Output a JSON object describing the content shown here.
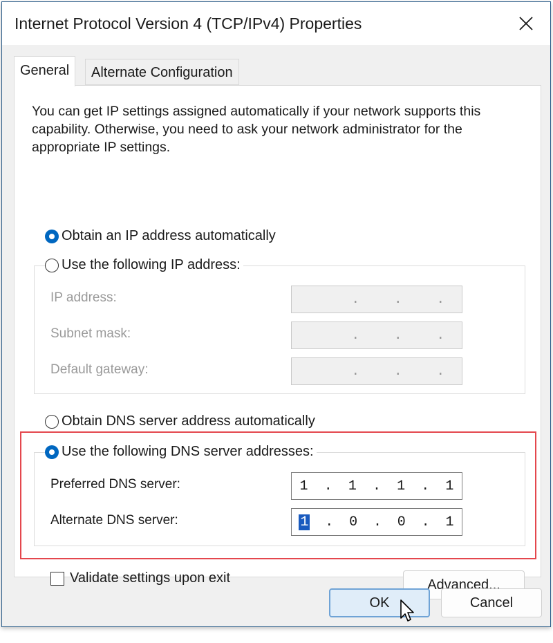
{
  "window": {
    "title": "Internet Protocol Version 4 (TCP/IPv4) Properties",
    "close_icon": "close-icon"
  },
  "tabs": [
    {
      "label": "General",
      "active": true
    },
    {
      "label": "Alternate Configuration",
      "active": false
    }
  ],
  "intro_text": "You can get IP settings assigned automatically if your network supports this capability. Otherwise, you need to ask your network administrator for the appropriate IP settings.",
  "ip_section": {
    "obtain_auto_label": "Obtain an IP address automatically",
    "use_following_label": "Use the following IP address:",
    "selected": "obtain_auto",
    "fields": [
      {
        "label": "IP address:",
        "value": ". . ."
      },
      {
        "label": "Subnet mask:",
        "value": ". . ."
      },
      {
        "label": "Default gateway:",
        "value": ". . ."
      }
    ]
  },
  "dns_section": {
    "obtain_auto_label": "Obtain DNS server address automatically",
    "use_following_label": "Use the following DNS server addresses:",
    "selected": "use_following",
    "preferred": {
      "label": "Preferred DNS server:",
      "octets": [
        "1",
        "1",
        "1",
        "1"
      ]
    },
    "alternate": {
      "label": "Alternate DNS server:",
      "octets": [
        "1",
        "0",
        "0",
        "1"
      ]
    }
  },
  "validate_label": "Validate settings upon exit",
  "validate_checked": false,
  "buttons": {
    "advanced": "Advanced...",
    "ok": "OK",
    "cancel": "Cancel"
  },
  "colors": {
    "accent": "#0067c0",
    "highlight_box": "#e4474d",
    "selection": "#1a5bbf"
  }
}
